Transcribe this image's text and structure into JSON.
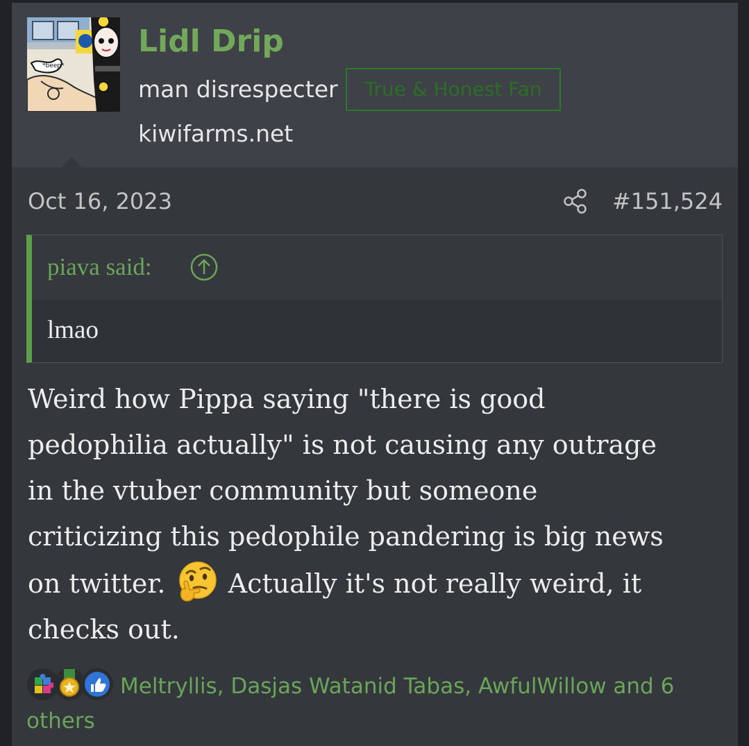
{
  "user": {
    "name": "Lidl Drip",
    "title": "man disrespecter",
    "banner": "True & Honest Fan",
    "site": "kiwifarms.net",
    "avatar_text": "*beep*",
    "accent_color": "#73a85b"
  },
  "post": {
    "date": "Oct 16, 2023",
    "number": "#151,524",
    "share_icon": "share-icon"
  },
  "quote": {
    "author": "piava said:",
    "jump_icon": "arrow-up-circle-icon",
    "body": "lmao",
    "bar_color": "#5f9e4c"
  },
  "message": {
    "line1": "Weird how Pippa saying \"there is good",
    "line2": "pedophilia actually\" is not causing any outrage",
    "line3": "in the vtuber community but someone",
    "line4": "criticizing this pedophile pandering is big news",
    "line5_a": "on twitter.",
    "line5_emoji": "thinking-face-emoji",
    "line5_b": "Actually it's not really weird, it",
    "line6": "checks out."
  },
  "reactions": {
    "icons": [
      "puzzle-icon",
      "medal-icon",
      "like-icon"
    ],
    "text": "Meltryllis, Dasjas Watanid Tabas, AwfulWillow and 6 others"
  }
}
